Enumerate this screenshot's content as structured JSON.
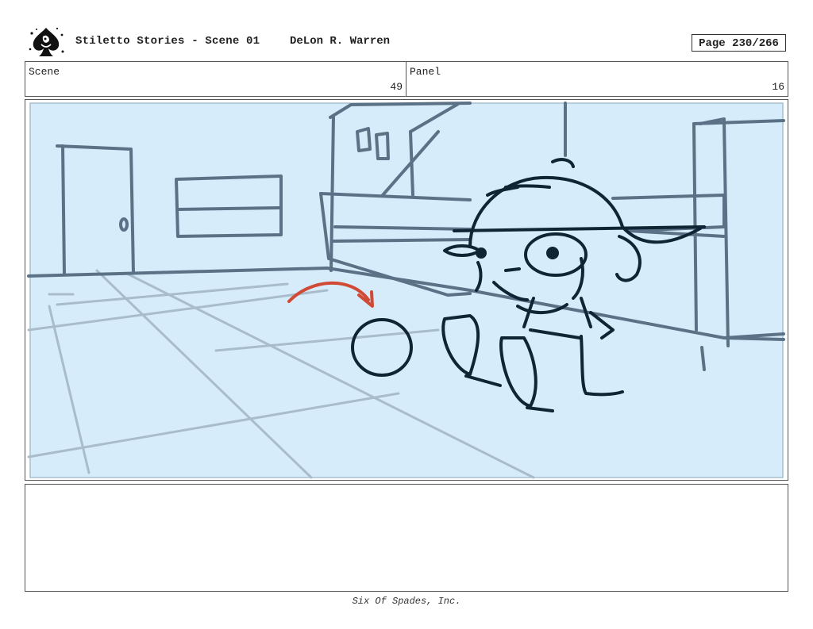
{
  "header": {
    "title": "Stiletto Stories - Scene 01",
    "author": "DeLon R. Warren",
    "page": "Page 230/266"
  },
  "info": {
    "scene_label": "Scene",
    "scene_value": "49",
    "panel_label": "Panel",
    "panel_value": "16"
  },
  "panel_art": {
    "description_icon": "storyboard-sketch",
    "background_color": "#d6ecfa",
    "line_color": "#5b7286",
    "ink_color": "#0f2434",
    "arrow_color": "#d04a35"
  },
  "footer": {
    "company": "Six Of Spades, Inc."
  }
}
